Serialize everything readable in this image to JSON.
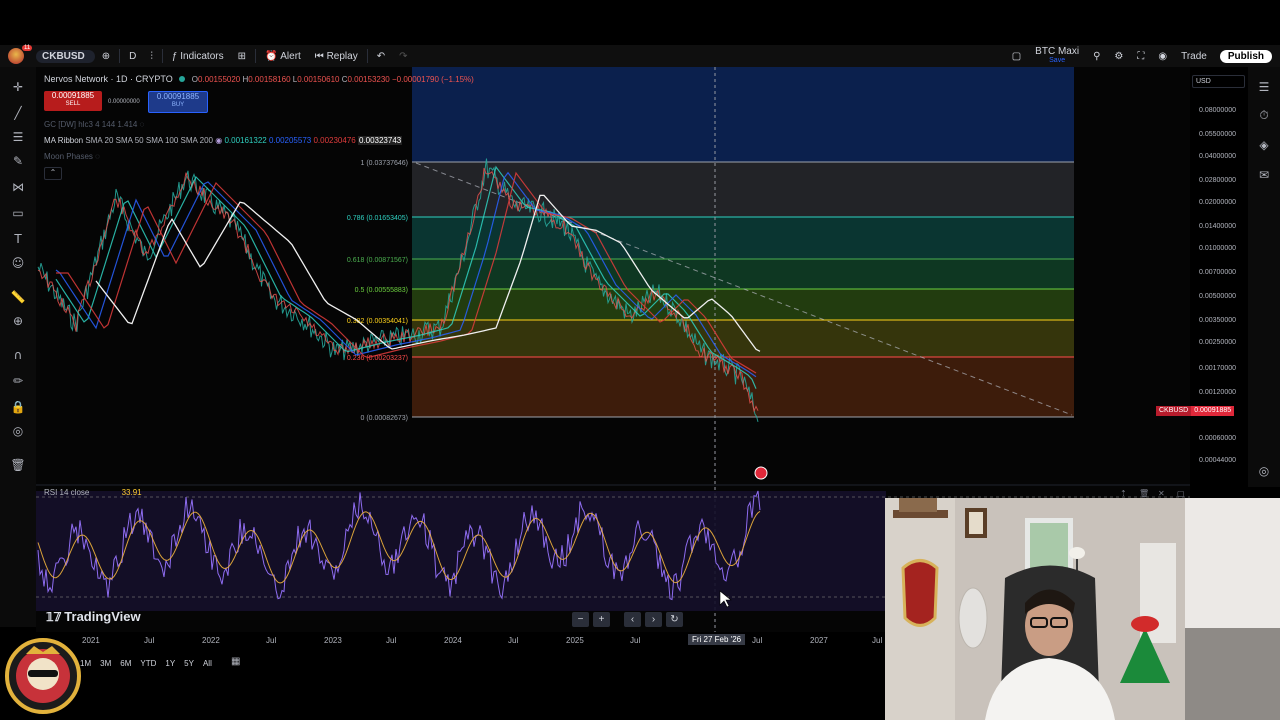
{
  "toolbar": {
    "symbol": "CKBUSD",
    "interval": "D",
    "indicators": "Indicators",
    "alert": "Alert",
    "replay": "Replay",
    "layout_name": "BTC Maxi",
    "layout_sub": "Save",
    "trade": "Trade",
    "publish": "Publish",
    "notif_count": "11"
  },
  "legend": {
    "title": "Nervos Network · 1D · CRYPTO",
    "ohlc": [
      {
        "k": "O",
        "v": "0.00155020"
      },
      {
        "k": "H",
        "v": "0.00158160"
      },
      {
        "k": "L",
        "v": "0.00150610"
      },
      {
        "k": "C",
        "v": "0.00153230"
      }
    ],
    "change": "−0.00001790 (−1.15%)",
    "sell_price": "0.00091885",
    "sell_label": "SELL",
    "spread": "0.00000000",
    "buy_price": "0.00091885",
    "buy_label": "BUY",
    "gc_line": "GC [DW] hlc3 4 144 1.414",
    "ma_label": "MA Ribbon",
    "ma_params": "SMA 20 SMA 50 SMA 100 SMA 200",
    "ma_values": [
      {
        "v": "0.00161322",
        "color": "#2fd0c0"
      },
      {
        "v": "0.00205573",
        "color": "#2962ff"
      },
      {
        "v": "0.00230476",
        "color": "#e03c3c"
      },
      {
        "v": "0.00323743",
        "color": "#ffffff"
      }
    ],
    "moon": "Moon Phases"
  },
  "fib": [
    {
      "label": "1 (0.03737646)",
      "color": "#9ea3ad"
    },
    {
      "label": "0.786 (0.01653405)",
      "color": "#2fd0c0"
    },
    {
      "label": "0.618 (0.00871567)",
      "color": "#4caf50"
    },
    {
      "label": "0.5 (0.00555883)",
      "color": "#6ccf3f"
    },
    {
      "label": "0.382 (0.00354041)",
      "color": "#ffd21a"
    },
    {
      "label": "0.236 (0.00203237)",
      "color": "#ff4b4b"
    },
    {
      "label": "0 (0.00082673)",
      "color": "#9ea3ad"
    }
  ],
  "price_scale": {
    "currency": "USD",
    "labels": [
      "0.08000000",
      "0.05500000",
      "0.04000000",
      "0.02800000",
      "0.02000000",
      "0.01400000",
      "0.01000000",
      "0.00700000",
      "0.00500000",
      "0.00350000",
      "0.00250000",
      "0.00170000",
      "0.00120000",
      "0.00060000",
      "0.00044000"
    ],
    "last_symbol": "CKBUSD",
    "last_price": "0.00091885"
  },
  "rsi": {
    "label": "RSI 14 close",
    "value": "33.91"
  },
  "time_axis": {
    "labels": [
      "2021",
      "Jul",
      "2022",
      "Jul",
      "2023",
      "Jul",
      "2024",
      "Jul",
      "2025",
      "Jul",
      "Jul",
      "2027",
      "Jul"
    ],
    "crosshair": "Fri 27 Feb '26"
  },
  "ranges": [
    "1M",
    "3M",
    "6M",
    "YTD",
    "1Y",
    "5Y",
    "All"
  ],
  "brand": "TradingView",
  "icon_names": [
    "crosshair-icon",
    "trendline-icon",
    "fib-icon",
    "brush-icon",
    "text-icon",
    "emoji-icon",
    "ruler-icon",
    "zoom-icon",
    "magnet-icon",
    "lock-icon",
    "eye-icon",
    "trash-icon"
  ]
}
